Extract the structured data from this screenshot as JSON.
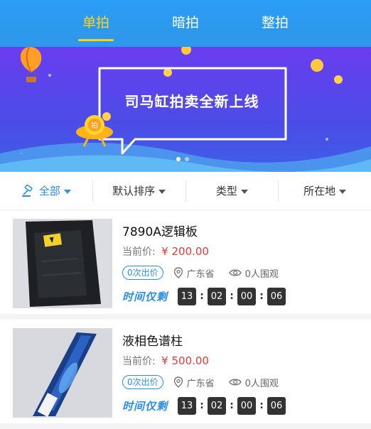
{
  "tabs": [
    {
      "label": "单拍",
      "active": true
    },
    {
      "label": "暗拍",
      "active": false
    },
    {
      "label": "整拍",
      "active": false
    }
  ],
  "banner": {
    "title": "司马缸拍卖全新上线",
    "robot_badge": "拍",
    "slide_count": 2,
    "active_slide": 1
  },
  "filters": [
    {
      "label": "全部",
      "active": true,
      "icon": "gavel-icon"
    },
    {
      "label": "默认排序",
      "active": false
    },
    {
      "label": "类型",
      "active": false
    },
    {
      "label": "所在地",
      "active": false
    }
  ],
  "items": [
    {
      "title": "7890A逻辑板",
      "price_label": "当前价:",
      "price": "¥ 200.00",
      "bids": "0次出价",
      "location": "广东省",
      "views": "0人围观",
      "timer_label": "时间仅剩",
      "timer": [
        "13",
        "02",
        "00",
        "06"
      ]
    },
    {
      "title": "液相色谱柱",
      "price_label": "当前价:",
      "price": "¥ 500.00",
      "bids": "0次出价",
      "location": "广东省",
      "views": "0人围观",
      "timer_label": "时间仅剩",
      "timer": [
        "13",
        "02",
        "00",
        "06"
      ]
    }
  ],
  "colors": {
    "accent": "#2a8ee8",
    "active_tab": "#ffd21a",
    "price": "#e53935"
  }
}
